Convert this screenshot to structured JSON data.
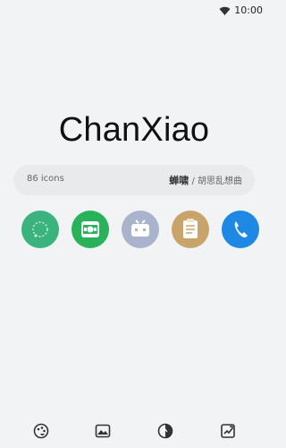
{
  "status_bar": {
    "time": "10:00"
  },
  "app": {
    "title": "ChanXiao"
  },
  "info_bar": {
    "count": "86 icons",
    "author": "蝉啸",
    "separator": "/",
    "subtitle": "胡思乱想曲"
  },
  "icons": [
    {
      "name": "green-swirl-icon",
      "color": "#3bb37f"
    },
    {
      "name": "camera-icon",
      "color": "#28b25a"
    },
    {
      "name": "tv-icon",
      "color": "#a9b3cc"
    },
    {
      "name": "notes-icon",
      "color": "#c9a46a"
    },
    {
      "name": "phone-icon",
      "color": "#1e88e5"
    }
  ],
  "bottom_nav": [
    {
      "name": "palette-icon"
    },
    {
      "name": "gallery-icon"
    },
    {
      "name": "theme-icon"
    },
    {
      "name": "apply-icon"
    }
  ]
}
